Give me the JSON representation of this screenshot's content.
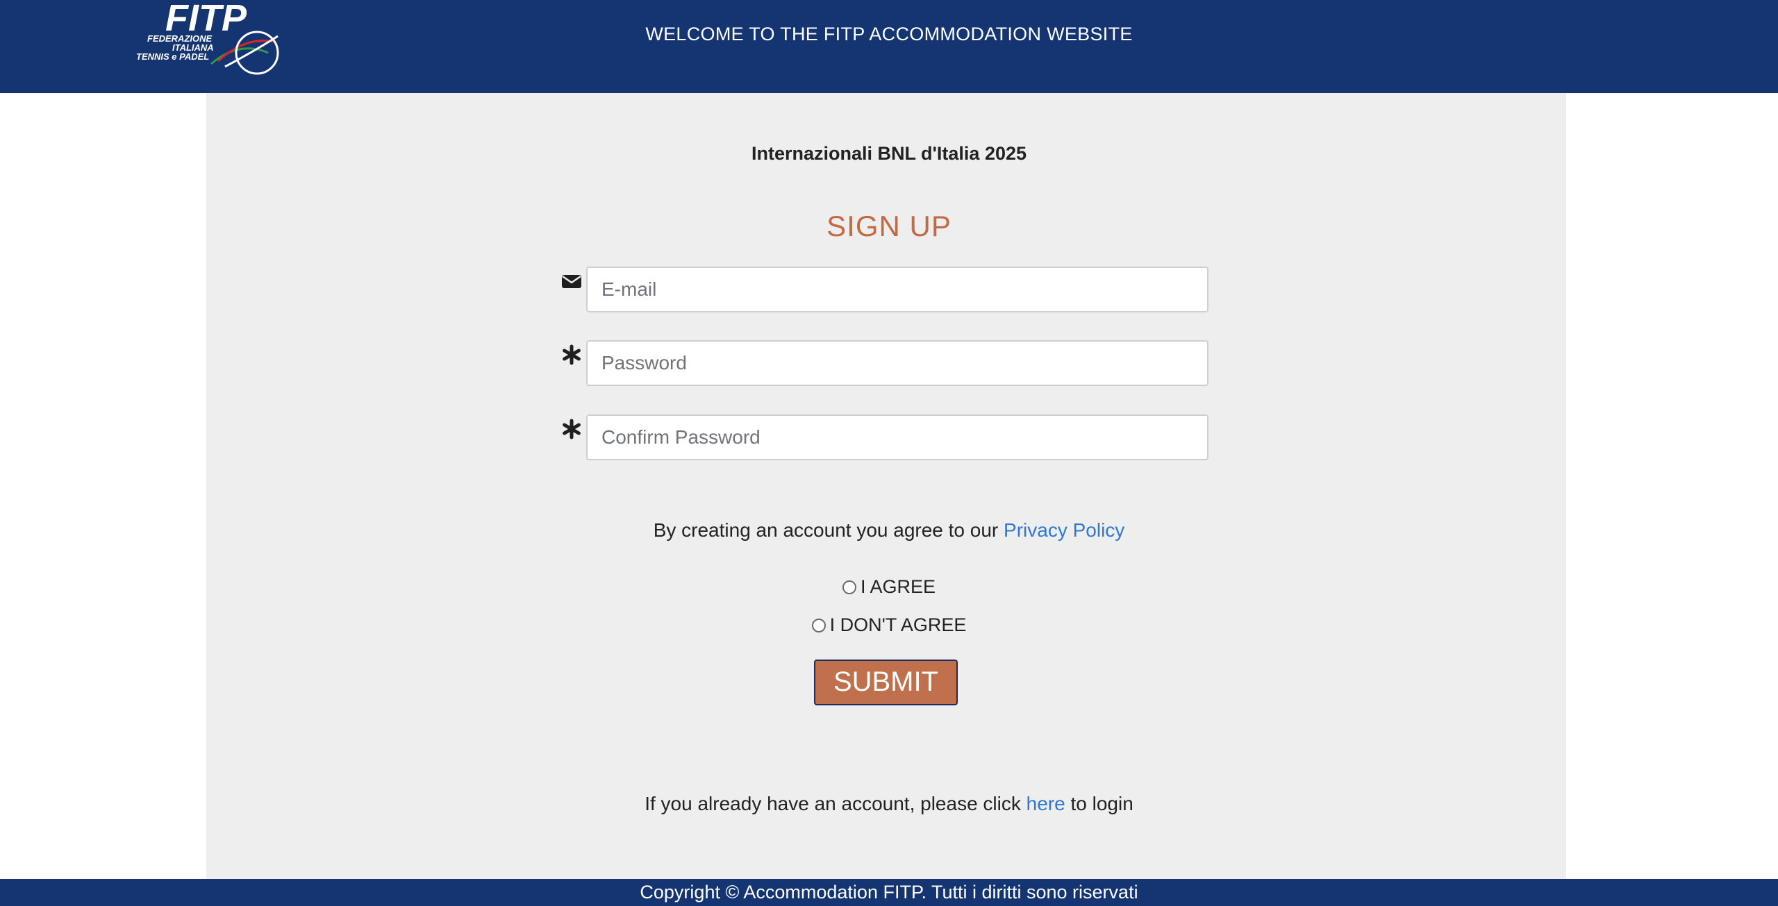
{
  "header": {
    "logo": {
      "icon": "fitp-logo",
      "brand": "FITP",
      "line1": "FEDERAZIONE",
      "line2": "ITALIANA",
      "line3": "TENNIS e PADEL"
    },
    "title": "WELCOME TO THE FITP ACCOMMODATION WEBSITE"
  },
  "main": {
    "event_name": "Internazionali BNL d'Italia 2025",
    "form_title": "SIGN UP",
    "fields": [
      {
        "icon": "envelope-icon",
        "placeholder": "E-mail",
        "value": ""
      },
      {
        "icon": "asterisk-icon",
        "placeholder": "Password",
        "value": ""
      },
      {
        "icon": "asterisk-icon",
        "placeholder": "Confirm Password",
        "value": ""
      }
    ],
    "privacy_text": "By creating an account you agree to our",
    "privacy_link": "Privacy Policy",
    "agree_label": "I AGREE",
    "disagree_label": "I DON'T AGREE",
    "submit_label": "SUBMIT",
    "login_prefix": "If you already have an account, please click",
    "login_link": "here",
    "login_suffix": "to login"
  },
  "footer": {
    "copyright": "Copyright © Accommodation FITP. Tutti i diritti sono riservati"
  },
  "colors": {
    "header_bg": "#143571",
    "panel_bg": "#eeeeee",
    "accent": "#c46a43",
    "link": "#2f78d6"
  }
}
